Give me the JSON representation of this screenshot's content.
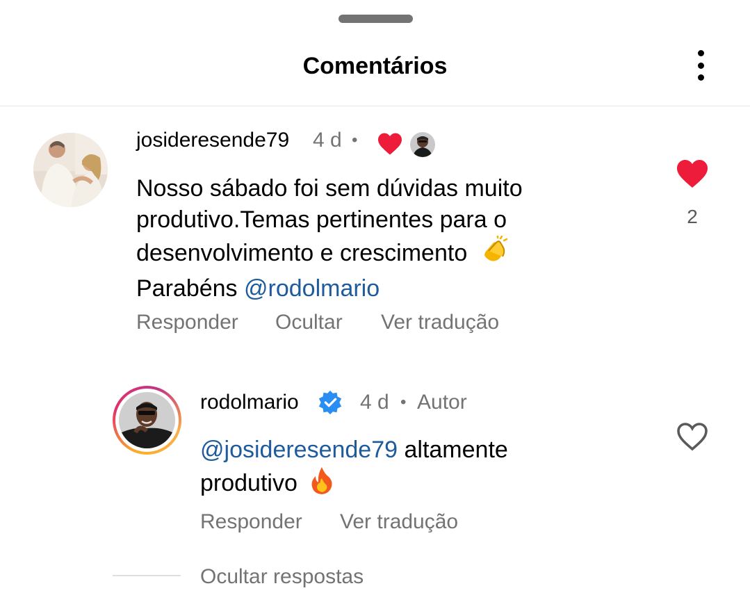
{
  "header": {
    "title": "Comentários"
  },
  "comments": [
    {
      "username": "josideresende79",
      "age": "4 d",
      "dot": "•",
      "text_1": "Nosso sábado foi sem dúvidas muito",
      "text_2": "produtivo.Temas pertinentes para o",
      "text_3": "desenvolvimento e crescimento",
      "text_4_prefix": "Parabéns ",
      "mention": "@rodolmario",
      "likes": "2",
      "actions": {
        "reply": "Responder",
        "hide": "Ocultar",
        "translate": "Ver tradução"
      },
      "liked_icon": "heart-filled",
      "author_liked_icon": "avatar-small"
    },
    {
      "username": "rodolmario",
      "verified_icon": "verified-badge",
      "age": "4 d",
      "dot": "•",
      "author_tag": "Autor",
      "mention": "@josideresende79",
      "text_1_suffix": " altamente",
      "text_2": "produtivo",
      "actions": {
        "reply": "Responder",
        "translate": "Ver tradução"
      },
      "like_icon": "heart-outline"
    }
  ],
  "hide_replies": "Ocultar respostas",
  "colors": {
    "like": "#ed1c3a",
    "mention": "#1e5b9c",
    "verified": "#2a8df2",
    "muted": "#737373"
  }
}
